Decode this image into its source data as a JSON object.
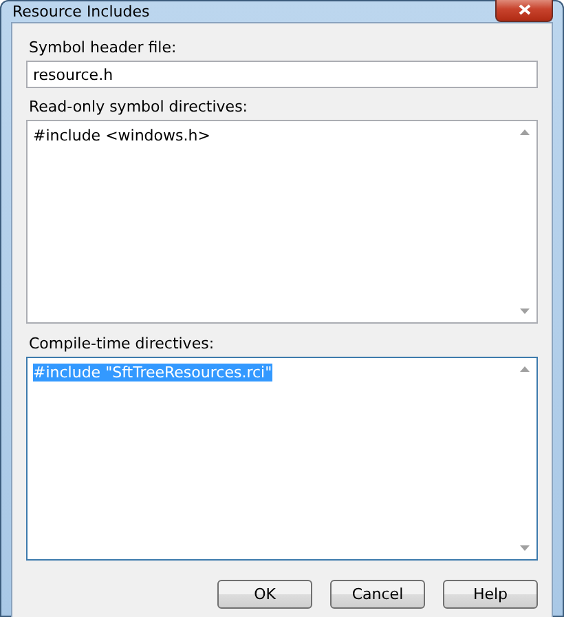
{
  "window": {
    "title": "Resource Includes"
  },
  "fields": [
    {
      "kind": "line",
      "label": "Symbol header file:",
      "value": "resource.h",
      "focused": false
    },
    {
      "kind": "multiline",
      "label": "Read-only symbol directives:",
      "value": "#include <windows.h>",
      "focused": false,
      "text_selected": false
    },
    {
      "kind": "multiline",
      "label": "Compile-time directives:",
      "value": "#include \"SftTreeResources.rci\"",
      "focused": true,
      "text_selected": true
    }
  ],
  "buttons": [
    {
      "label": "OK"
    },
    {
      "label": "Cancel"
    },
    {
      "label": "Help"
    }
  ]
}
